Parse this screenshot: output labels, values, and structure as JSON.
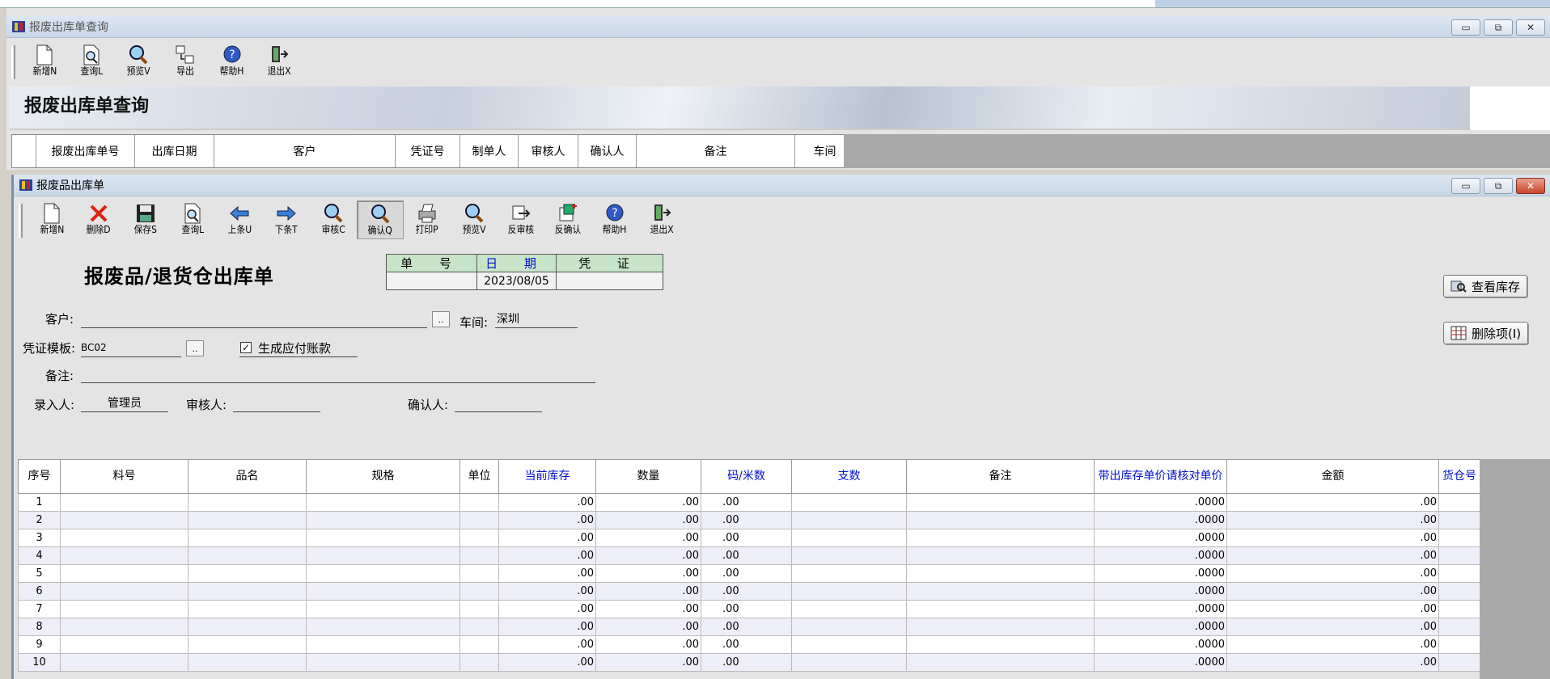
{
  "back_window": {
    "title": "报废出库单查询",
    "toolbar": [
      {
        "label": "新增N",
        "icon": "new-doc-icon"
      },
      {
        "label": "查询L",
        "icon": "query-icon"
      },
      {
        "label": "预览V",
        "icon": "preview-icon"
      },
      {
        "label": "导出",
        "icon": "export-icon"
      },
      {
        "label": "帮助H",
        "icon": "help-icon"
      },
      {
        "label": "退出X",
        "icon": "exit-icon"
      }
    ],
    "banner_title": "报废出库单查询",
    "columns": [
      "报废出库单号",
      "出库日期",
      "客户",
      "凭证号",
      "制单人",
      "审核人",
      "确认人",
      "备注",
      "车间"
    ]
  },
  "front_window": {
    "title": "报废品出库单",
    "toolbar": [
      {
        "label": "新增N",
        "icon": "new-doc-icon"
      },
      {
        "label": "删除D",
        "icon": "delete-icon"
      },
      {
        "label": "保存S",
        "icon": "save-icon"
      },
      {
        "label": "查询L",
        "icon": "query-icon"
      },
      {
        "label": "上条U",
        "icon": "arrow-left-icon"
      },
      {
        "label": "下条T",
        "icon": "arrow-right-icon"
      },
      {
        "label": "审核C",
        "icon": "audit-icon"
      },
      {
        "label": "确认Q",
        "icon": "confirm-icon"
      },
      {
        "label": "打印P",
        "icon": "print-icon"
      },
      {
        "label": "预览V",
        "icon": "preview-icon"
      },
      {
        "label": "反审核",
        "icon": "unaudit-icon"
      },
      {
        "label": "反确认",
        "icon": "unconfirm-icon"
      },
      {
        "label": "帮助H",
        "icon": "help-icon"
      },
      {
        "label": "退出X",
        "icon": "exit-icon"
      }
    ],
    "form_title": "报废品/退货仓出库单",
    "info": {
      "h_number": "单 号",
      "h_date": "日 期",
      "h_voucher": "凭 证",
      "number": "",
      "date": "2023/08/05",
      "voucher": ""
    },
    "fields": {
      "customer_label": "客户:",
      "customer_value": "",
      "workshop_label": "车间:",
      "workshop_value": "深圳",
      "template_label": "凭证模板:",
      "template_value": "BC02",
      "payable_label": "生成应付账款",
      "payable_checked": "✓",
      "remark_label": "备注:",
      "remark_value": "",
      "entered_label": "录入人:",
      "entered_value": "管理员",
      "auditor_label": "审核人:",
      "auditor_value": "",
      "confirmer_label": "确认人:",
      "confirmer_value": "",
      "browse": ".."
    },
    "buttons": {
      "view_stock": "查看库存",
      "delete_item": "删除项(I)"
    },
    "grid": {
      "columns": [
        "序号",
        "料号",
        "品名",
        "规格",
        "单位",
        "当前库存",
        "数量",
        "码/米数",
        "支数",
        "备注",
        "带出库存单价请核对单价",
        "金额",
        "货仓号"
      ],
      "rows": [
        [
          "1",
          "",
          "",
          "",
          "",
          ".00",
          ".00",
          ".00",
          "",
          "",
          ".0000",
          ".00",
          ""
        ],
        [
          "2",
          "",
          "",
          "",
          "",
          ".00",
          ".00",
          ".00",
          "",
          "",
          ".0000",
          ".00",
          ""
        ],
        [
          "3",
          "",
          "",
          "",
          "",
          ".00",
          ".00",
          ".00",
          "",
          "",
          ".0000",
          ".00",
          ""
        ],
        [
          "4",
          "",
          "",
          "",
          "",
          ".00",
          ".00",
          ".00",
          "",
          "",
          ".0000",
          ".00",
          ""
        ],
        [
          "5",
          "",
          "",
          "",
          "",
          ".00",
          ".00",
          ".00",
          "",
          "",
          ".0000",
          ".00",
          ""
        ],
        [
          "6",
          "",
          "",
          "",
          "",
          ".00",
          ".00",
          ".00",
          "",
          "",
          ".0000",
          ".00",
          ""
        ],
        [
          "7",
          "",
          "",
          "",
          "",
          ".00",
          ".00",
          ".00",
          "",
          "",
          ".0000",
          ".00",
          ""
        ],
        [
          "8",
          "",
          "",
          "",
          "",
          ".00",
          ".00",
          ".00",
          "",
          "",
          ".0000",
          ".00",
          ""
        ],
        [
          "9",
          "",
          "",
          "",
          "",
          ".00",
          ".00",
          ".00",
          "",
          "",
          ".0000",
          ".00",
          ""
        ],
        [
          "10",
          "",
          "",
          "",
          "",
          ".00",
          ".00",
          ".00",
          "",
          "",
          ".0000",
          ".00",
          ""
        ]
      ]
    }
  },
  "colors": {
    "blue_header": "#0010d0",
    "info_header_bg": "#c8e4c8",
    "title_gradient_top": "#dde7f2"
  }
}
